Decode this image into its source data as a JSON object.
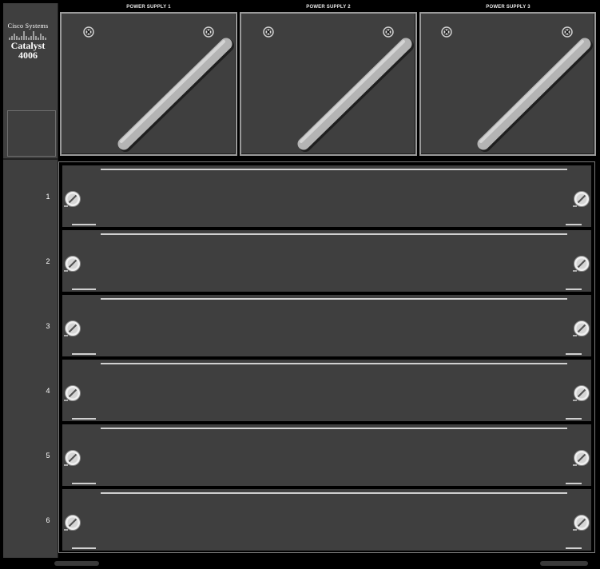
{
  "chassis": {
    "brand_company": "Cisco Systems",
    "brand_model_name": "Catalyst",
    "brand_model_number": "4006"
  },
  "power_supplies": [
    {
      "label": "POWER SUPPLY 1"
    },
    {
      "label": "POWER SUPPLY 2"
    },
    {
      "label": "POWER SUPPLY 3"
    }
  ],
  "slots": [
    {
      "number": "1"
    },
    {
      "number": "2"
    },
    {
      "number": "3"
    },
    {
      "number": "4"
    },
    {
      "number": "5"
    },
    {
      "number": "6"
    }
  ],
  "colors": {
    "panel": "#3f3f3f",
    "frame": "#000000",
    "handle": "#b4b4b4",
    "border": "#9a9a9a",
    "text": "#ffffff"
  },
  "icons": {
    "screw": "screw-icon",
    "handle": "handle-icon",
    "logo_bars": "cisco-bridge-icon"
  }
}
